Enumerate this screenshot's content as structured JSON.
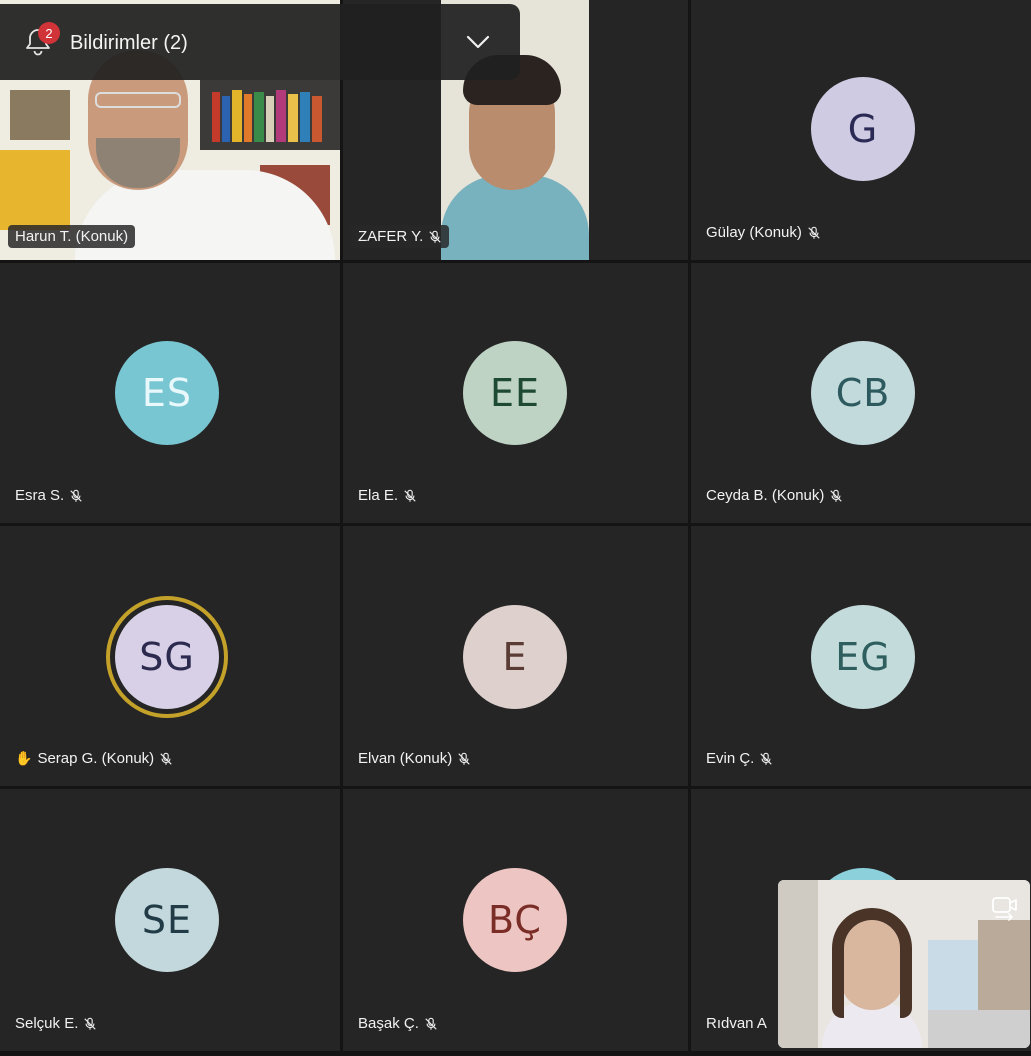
{
  "notification": {
    "count": "2",
    "label": "Bildirimler (2)"
  },
  "participants": [
    {
      "name": "Harun T. (Konuk)",
      "initials": "",
      "video": true
    },
    {
      "name": "ZAFER Y.",
      "initials": "",
      "video": true
    },
    {
      "name": "Gülay (Konuk)",
      "initials": "G",
      "bg": "#cfcbe3",
      "fg": "#2b2a55"
    },
    {
      "name": "Esra S.",
      "initials": "ES",
      "bg": "#79c6d3",
      "fg": "#e8f8fb"
    },
    {
      "name": "Ela E.",
      "initials": "EE",
      "bg": "#bfd3c4",
      "fg": "#1e4a33"
    },
    {
      "name": "Ceyda B. (Konuk)",
      "initials": "CB",
      "bg": "#c2dadc",
      "fg": "#2d5a5e"
    },
    {
      "name": "Serap G. (Konuk)",
      "initials": "SG",
      "bg": "#d7d0e6",
      "fg": "#2d2a4f",
      "hand": "✋"
    },
    {
      "name": "Elvan (Konuk)",
      "initials": "E",
      "bg": "#ddd0cd",
      "fg": "#5b3c35"
    },
    {
      "name": "Evin Ç.",
      "initials": "EG",
      "bg": "#c3dbdb",
      "fg": "#2e5e5e"
    },
    {
      "name": "Selçuk E.",
      "initials": "SE",
      "bg": "#c3d8dd",
      "fg": "#223c47"
    },
    {
      "name": "Başak Ç.",
      "initials": "BÇ",
      "bg": "#edc5c2",
      "fg": "#7a2d26"
    },
    {
      "name": "Rıdvan A",
      "initials": "",
      "bg": "#8cd0dc",
      "fg": "#1f4d55"
    }
  ],
  "icons": {
    "mic_off": "mic-off-icon",
    "bell": "bell-icon",
    "chevron": "chevron-down-icon",
    "switch_camera": "switch-camera-icon"
  }
}
